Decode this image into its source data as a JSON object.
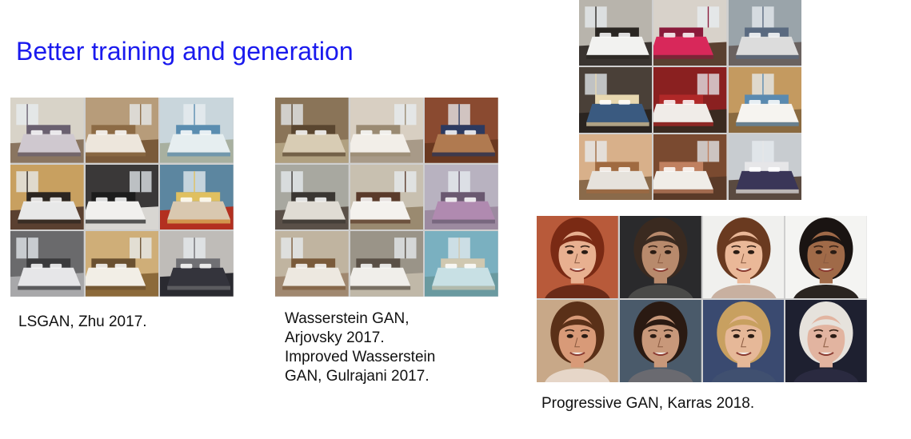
{
  "slide": {
    "subtitle": "Better training and generation"
  },
  "figures": {
    "lsgan": {
      "caption_lines": [
        "LSGAN, Zhu 2017."
      ],
      "tiles": [
        {
          "wall": "#d8d3c8",
          "floor": "#8a7560",
          "bed": "#cfc8cf",
          "accent": "#6a6070"
        },
        {
          "wall": "#b79c7a",
          "floor": "#7a5a3a",
          "bed": "#ede6dc",
          "accent": "#8d6b45"
        },
        {
          "wall": "#c9d6dc",
          "floor": "#a8b0a0",
          "bed": "#e6eef0",
          "accent": "#5a8db0"
        },
        {
          "wall": "#c8a060",
          "floor": "#5a4030",
          "bed": "#e8e8e8",
          "accent": "#2b2520"
        },
        {
          "wall": "#3a3838",
          "floor": "#d8d6d2",
          "bed": "#f1f0ee",
          "accent": "#1c1c1c"
        },
        {
          "wall": "#5c86a0",
          "floor": "#b33020",
          "bed": "#d9c8b0",
          "accent": "#e0c060"
        },
        {
          "wall": "#6a6a6c",
          "floor": "#a8a8aa",
          "bed": "#e6e6e8",
          "accent": "#3a3a3c"
        },
        {
          "wall": "#cfae78",
          "floor": "#8c6a3a",
          "bed": "#f2eee6",
          "accent": "#6a5030"
        },
        {
          "wall": "#bfbcb8",
          "floor": "#2a2a30",
          "bed": "#34343c",
          "accent": "#707074"
        }
      ]
    },
    "wgan": {
      "caption_lines": [
        "Wasserstein GAN,",
        "Arjovsky 2017.",
        "Improved Wasserstein",
        "GAN, Gulrajani 2017."
      ],
      "tiles": [
        {
          "wall": "#8a7458",
          "floor": "#b0a080",
          "bed": "#d8ccb4",
          "accent": "#5a4630"
        },
        {
          "wall": "#d8cfc2",
          "floor": "#a89a88",
          "bed": "#f2eee8",
          "accent": "#9a8a72"
        },
        {
          "wall": "#8a4a30",
          "floor": "#6a3820",
          "bed": "#b07a50",
          "accent": "#2c3a60"
        },
        {
          "wall": "#a8a8a0",
          "floor": "#5a5048",
          "bed": "#e0dcd4",
          "accent": "#3a3632"
        },
        {
          "wall": "#c8c0b0",
          "floor": "#9a8a70",
          "bed": "#f4f2ee",
          "accent": "#5a3a2a"
        },
        {
          "wall": "#b8b2c0",
          "floor": "#9c8aa0",
          "bed": "#b08ab0",
          "accent": "#6a5870"
        },
        {
          "wall": "#c0b4a0",
          "floor": "#a08870",
          "bed": "#ede8e0",
          "accent": "#7a5a3a"
        },
        {
          "wall": "#9a9488",
          "floor": "#c0b8a8",
          "bed": "#f0eeea",
          "accent": "#5a5046"
        },
        {
          "wall": "#7ab0c0",
          "floor": "#6a9aa0",
          "bed": "#c8e0e4",
          "accent": "#d0c8b0"
        }
      ]
    },
    "progan_bedrooms": {
      "tiles": [
        {
          "wall": "#b8b4ac",
          "floor": "#3a3430",
          "bed": "#f2f2f0",
          "accent": "#2a2622"
        },
        {
          "wall": "#d8d2ca",
          "floor": "#5a4030",
          "bed": "#d8285a",
          "accent": "#8a1a3a"
        },
        {
          "wall": "#9aa4aa",
          "floor": "#6a6260",
          "bed": "#dcdcdc",
          "accent": "#5a6a80"
        },
        {
          "wall": "#4a4038",
          "floor": "#2a2420",
          "bed": "#3a5a80",
          "accent": "#e8d8b0"
        },
        {
          "wall": "#8a2020",
          "floor": "#3a2a20",
          "bed": "#f0ece8",
          "accent": "#b02828"
        },
        {
          "wall": "#c49a60",
          "floor": "#8a6a40",
          "bed": "#f6f4f0",
          "accent": "#5a8ab0"
        },
        {
          "wall": "#d8b08a",
          "floor": "#8a6a4a",
          "bed": "#e6e2dc",
          "accent": "#a06a40"
        },
        {
          "wall": "#7a4a30",
          "floor": "#5a3a28",
          "bed": "#f0ede8",
          "accent": "#c08060"
        },
        {
          "wall": "#c8ccd0",
          "floor": "#5a4a40",
          "bed": "#3a3658",
          "accent": "#e6e6e8"
        }
      ]
    },
    "progan_faces": {
      "caption_lines": [
        "Progressive GAN, Karras 2018."
      ],
      "tiles": [
        {
          "bg": "#b85a3a",
          "skin": "#e8b090",
          "hair": "#7a2a14",
          "shirt": "#6a2a18"
        },
        {
          "bg": "#2a2a2c",
          "skin": "#b88a6c",
          "hair": "#3a2a20",
          "shirt": "#4a4a48"
        },
        {
          "bg": "#f0f0ee",
          "skin": "#eab898",
          "hair": "#6a3a20",
          "shirt": "#c8b0a0"
        },
        {
          "bg": "#f4f4f2",
          "skin": "#a06a48",
          "hair": "#1a1412",
          "shirt": "#2a2420"
        },
        {
          "bg": "#c8a888",
          "skin": "#d89a78",
          "hair": "#5a3018",
          "shirt": "#e6d6c8"
        },
        {
          "bg": "#4a5a6a",
          "skin": "#c8987a",
          "hair": "#2a1a12",
          "shirt": "#6a6a70"
        },
        {
          "bg": "#3a4a70",
          "skin": "#e6b898",
          "hair": "#c8a060",
          "shirt": "#405070"
        },
        {
          "bg": "#1e2030",
          "skin": "#e2b4a0",
          "hair": "#e6e2dc",
          "shirt": "#2a2a40"
        }
      ]
    }
  }
}
